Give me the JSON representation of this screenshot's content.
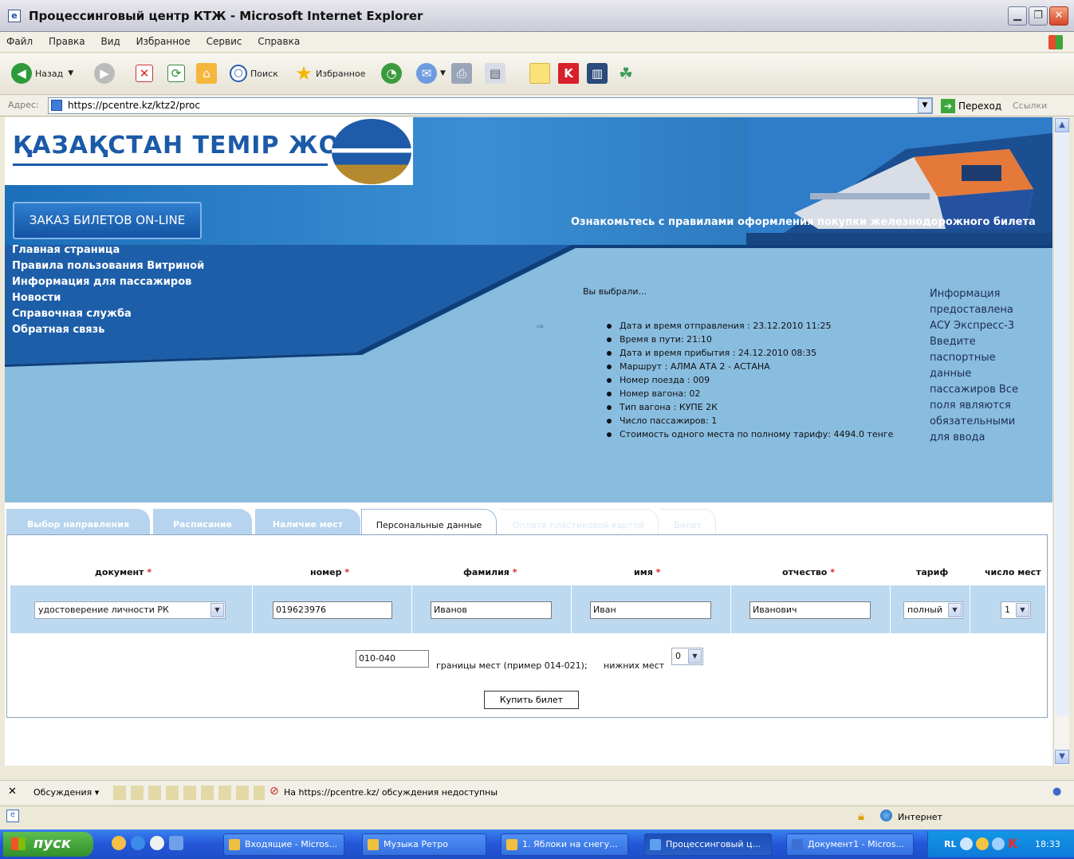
{
  "window": {
    "title": "Процессинговый центр КТЖ - Microsoft Internet Explorer"
  },
  "menu": [
    "Файл",
    "Правка",
    "Вид",
    "Избранное",
    "Сервис",
    "Справка"
  ],
  "toolbar": {
    "back": "Назад",
    "search": "Поиск",
    "favorites": "Избранное"
  },
  "address": {
    "label": "Адрес:",
    "url": "https://pcentre.kz/ktz2/proc",
    "go": "Переход",
    "links": "Ссылки"
  },
  "site": {
    "logo": "ҚАЗАҚСТАН ТЕМІР ЖОЛЫ",
    "order_button": "ЗАКАЗ БИЛЕТОВ ON-LINE",
    "rules_link": "Ознакомьтесь с правилами оформления покупки железнодорожного билета",
    "nav": [
      "Главная страница",
      "Правила пользования Витриной",
      "Информация для пассажиров",
      "Новости",
      "Справочная служба",
      "Обратная связь"
    ]
  },
  "selection": {
    "title": "Вы выбрали...",
    "items": [
      "Дата и время отправления : 23.12.2010 11:25",
      "Время в пути: 21:10",
      "Дата и время прибытия : 24.12.2010 08:35",
      "Маршрут : АЛМА АТА 2 - АСТАНА",
      "Номер поезда : 009",
      "Номер вагона: 02",
      "Тип вагона : КУПЕ 2К",
      "Число пассажиров: 1",
      "Стоимость одного места по полному тарифу: 4494.0 тенге"
    ],
    "info": "Информация предоставлена АСУ Экспресс-3 Введите паспортные данные пассажиров Все поля являются обязательными для ввода"
  },
  "tabs": [
    "Выбор направления",
    "Расписание",
    "Наличие мест",
    "Персональные данные",
    "Оплата пластиковой картой",
    "Билет"
  ],
  "form": {
    "headers": [
      "документ",
      "номер",
      "фамилия",
      "имя",
      "отчество",
      "тариф",
      "число мест"
    ],
    "document": "удостоверение личности РК",
    "number": "019623976",
    "surname": "Иванов",
    "name": "Иван",
    "patronymic": "Иванович",
    "tariff": "полный",
    "seats": "1",
    "seat_range": "010-040",
    "seat_range_hint": "границы мест (пример 014-021);",
    "lower_label": "нижних мест",
    "lower_value": "0",
    "buy": "Купить билет"
  },
  "discuss": {
    "label": "Обсуждения",
    "message": "На https://pcentre.kz/ обсуждения недоступны"
  },
  "status": {
    "zone": "Интернет"
  },
  "taskbar": {
    "start": "пуск",
    "tasks": [
      "Входящие - Micros...",
      "Музыка Ретро",
      "1. Яблоки на снегу...",
      "Процессинговый ц...",
      "Документ1 - Micros..."
    ],
    "lang": "RL",
    "clock": "18:33"
  }
}
